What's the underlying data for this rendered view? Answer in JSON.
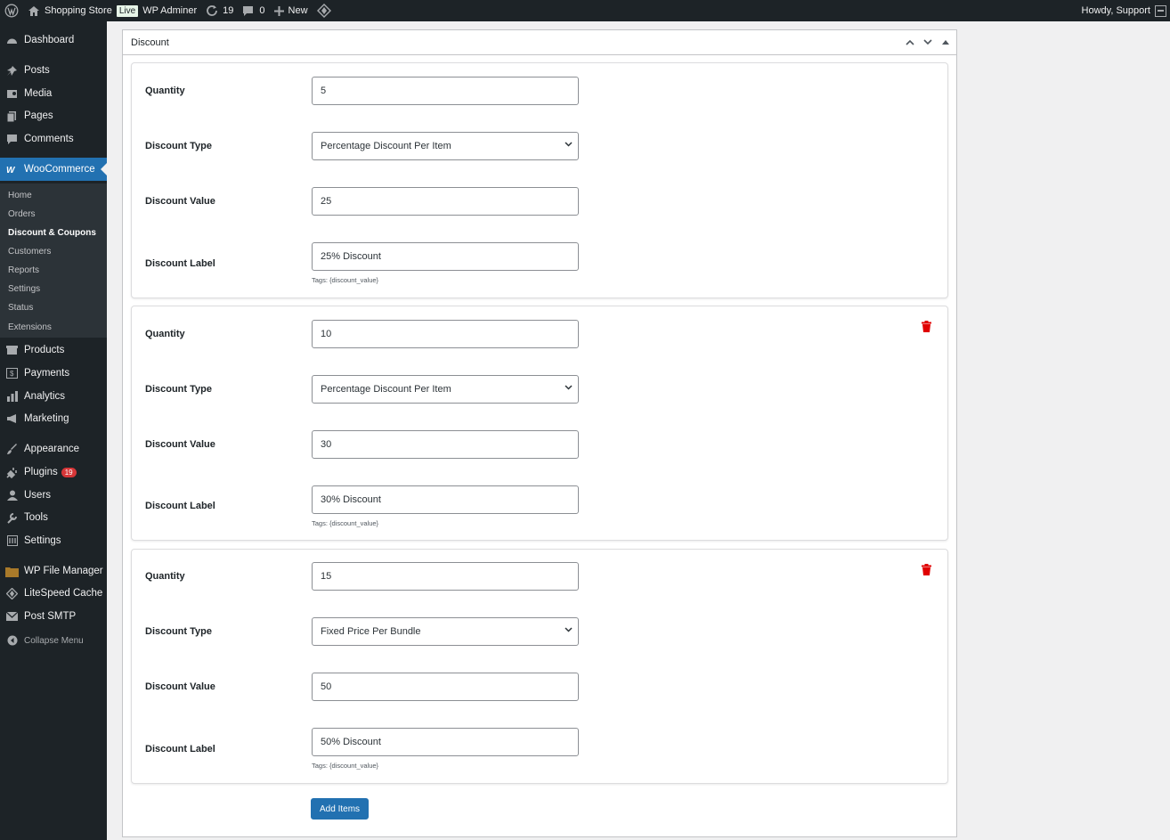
{
  "adminbar": {
    "site_name": "Shopping Store",
    "live_label": "Live",
    "admin_label": "WP Adminer",
    "updates_count": "19",
    "comments_count": "0",
    "new_label": "New",
    "howdy": "Howdy, Support"
  },
  "sidebar": {
    "dashboard": "Dashboard",
    "posts": "Posts",
    "media": "Media",
    "pages": "Pages",
    "comments": "Comments",
    "woocommerce": "WooCommerce",
    "submenu": [
      "Home",
      "Orders",
      "Discount & Coupons",
      "Customers",
      "Reports",
      "Settings",
      "Status",
      "Extensions"
    ],
    "products": "Products",
    "payments": "Payments",
    "analytics": "Analytics",
    "marketing": "Marketing",
    "appearance": "Appearance",
    "plugins": "Plugins",
    "plugins_badge": "19",
    "users": "Users",
    "tools": "Tools",
    "settings": "Settings",
    "wp_file_manager": "WP File Manager",
    "litespeed": "LiteSpeed Cache",
    "post_smtp": "Post SMTP",
    "collapse": "Collapse Menu"
  },
  "panel": {
    "title": "Discount",
    "labels": {
      "quantity": "Quantity",
      "discount_type": "Discount Type",
      "discount_value": "Discount Value",
      "discount_label": "Discount Label",
      "tags": "Tags: {discount_value}"
    },
    "items": [
      {
        "quantity": "5",
        "type": "Percentage Discount Per Item",
        "value": "25",
        "label": "25% Discount"
      },
      {
        "quantity": "10",
        "type": "Percentage Discount Per Item",
        "value": "30",
        "label": "30% Discount"
      },
      {
        "quantity": "15",
        "type": "Fixed Price Per Bundle",
        "value": "50",
        "label": "50% Discount"
      }
    ],
    "add_button": "Add Items"
  },
  "colors": {
    "accent": "#2271b1",
    "trash": "#e00000",
    "sidebar_bg": "#1d2327"
  }
}
